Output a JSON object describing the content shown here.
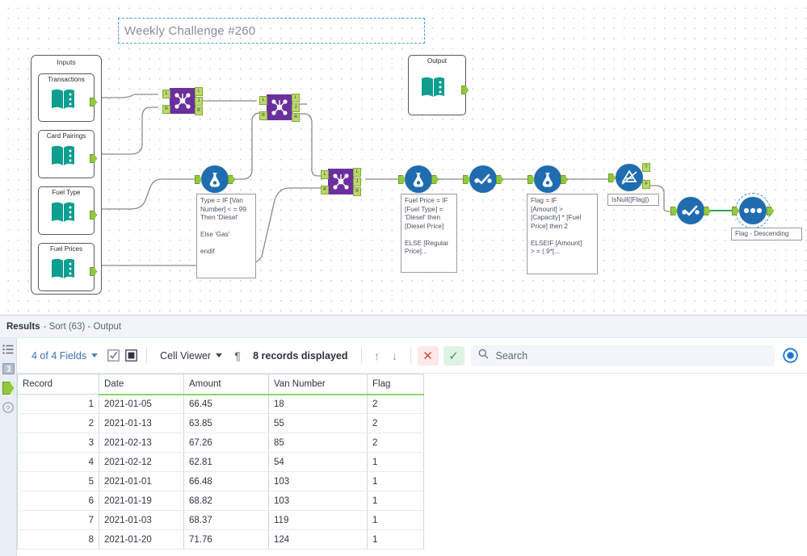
{
  "canvas": {
    "title_annotation": "Weekly Challenge #260",
    "inputs_container_label": "Inputs",
    "input_nodes": [
      {
        "label": "Transactions"
      },
      {
        "label": "Card Pairings"
      },
      {
        "label": "Fuel Type"
      },
      {
        "label": "Fuel Prices"
      }
    ],
    "output_node": {
      "label": "Output"
    },
    "join_tools": [
      {
        "name": "join-1",
        "ports": [
          "L",
          "J",
          "R"
        ]
      },
      {
        "name": "join-2",
        "ports": [
          "L",
          "J",
          "R"
        ]
      },
      {
        "name": "join-3",
        "ports": [
          "L",
          "J",
          "R"
        ]
      }
    ],
    "formula_annotations": [
      "Type = IF [Van\nNumber] < = 99\nThen 'Diesel'\n\nElse 'Gas'\n\nendif",
      "Fuel Price = IF\n[Fuel Type] =\n'Diesel' then\n[Diesel Price]\n\nELSE [Regular\nPrice]...",
      "Flag = IF\n[Amount] >\n[Capacity] * [Fuel\nPrice] then 2\n\nELSEIF [Amount]\n> = (.9*[..."
    ],
    "filter_annotation": "IsNull([Flag])",
    "filter_ports": [
      "T",
      "F"
    ],
    "sort_annotation": "Flag - Descending",
    "colors": {
      "join_purple": "#6b2f9e",
      "tool_blue": "#1f6cb0",
      "input_teal": "#0e9e8f",
      "connector_green": "#93c83e",
      "selection_blue": "#3d8fd8"
    }
  },
  "results": {
    "header_title": "Results",
    "header_subtitle": "- Sort (63) - Output",
    "toolbar": {
      "fields_label": "4 of 4 Fields",
      "view_label": "Cell Viewer",
      "records_label": "8 records displayed",
      "pilcrow": "¶",
      "arrow_up": "↑",
      "arrow_down": "↓",
      "reject_label": "✕",
      "accept_label": "✓",
      "search_placeholder": "Search",
      "search_value": ""
    },
    "table": {
      "columns": [
        "Record",
        "Date",
        "Amount",
        "Van Number",
        "Flag"
      ],
      "rows": [
        [
          "1",
          "2021-01-05",
          "66.45",
          "18",
          "2"
        ],
        [
          "2",
          "2021-01-13",
          "63.85",
          "55",
          "2"
        ],
        [
          "3",
          "2021-02-13",
          "67.26",
          "85",
          "2"
        ],
        [
          "4",
          "2021-02-12",
          "62.81",
          "54",
          "1"
        ],
        [
          "5",
          "2021-01-01",
          "66.48",
          "103",
          "1"
        ],
        [
          "6",
          "2021-01-19",
          "68.82",
          "103",
          "1"
        ],
        [
          "7",
          "2021-01-03",
          "68.37",
          "119",
          "1"
        ],
        [
          "8",
          "2021-01-20",
          "71.76",
          "124",
          "1"
        ]
      ]
    }
  }
}
